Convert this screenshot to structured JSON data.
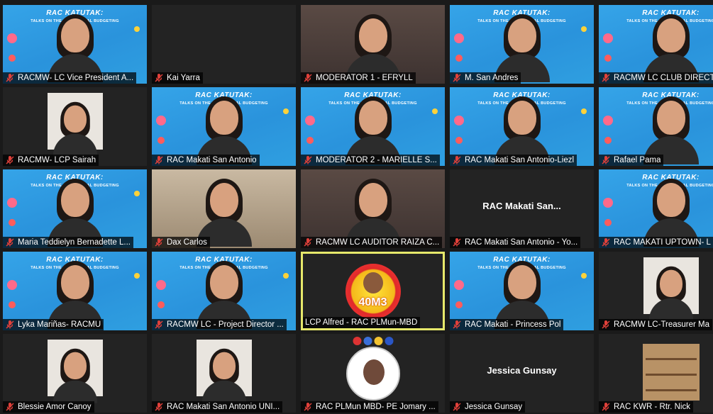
{
  "meeting": {
    "banner": {
      "title": "RAC KATUTAK:",
      "subtitle": "TALKS ON THE NEW NORMAL BUDGETING"
    },
    "participants": [
      {
        "name": "RACMW- LC Vice President A...",
        "muted": true,
        "view": "banner"
      },
      {
        "name": "Kai Yarra",
        "muted": true,
        "view": "plain"
      },
      {
        "name": "MODERATOR 1 - EFRYLL",
        "muted": true,
        "view": "room"
      },
      {
        "name": "M. San Andres",
        "muted": true,
        "view": "banner"
      },
      {
        "name": "RACMW LC CLUB DIRECTO",
        "muted": true,
        "view": "banner"
      },
      {
        "name": "RACMW- LCP Sairah",
        "muted": true,
        "view": "photo"
      },
      {
        "name": "RAC Makati San Antonio",
        "muted": true,
        "view": "banner"
      },
      {
        "name": "MODERATOR 2 - MARIELLE S...",
        "muted": true,
        "view": "banner"
      },
      {
        "name": "RAC Makati San Antonio-Liezl",
        "muted": true,
        "view": "banner"
      },
      {
        "name": "Rafael Pama",
        "muted": true,
        "view": "banner"
      },
      {
        "name": "Maria Teddielyn Bernadette L...",
        "muted": true,
        "view": "banner"
      },
      {
        "name": "Dax Carlos",
        "muted": true,
        "view": "room2"
      },
      {
        "name": "RACMW LC AUDITOR RAIZA C...",
        "muted": true,
        "view": "room"
      },
      {
        "name": "RAC Makati San Antonio - Yo...",
        "muted": true,
        "view": "name",
        "display": "RAC Makati San..."
      },
      {
        "name": "RAC MAKATI UPTOWN- L",
        "muted": true,
        "view": "banner"
      },
      {
        "name": "Lyka Mariñas- RACMU",
        "muted": true,
        "view": "photo-banner"
      },
      {
        "name": "RACMW LC - Project Director ...",
        "muted": true,
        "view": "banner"
      },
      {
        "name": "LCP Alfred - RAC PLMun-MBD",
        "muted": false,
        "view": "avatar",
        "avatar_text": "40M3",
        "active": true
      },
      {
        "name": "RAC Makati - Princess Pol",
        "muted": true,
        "view": "banner"
      },
      {
        "name": "RACMW LC-Treasurer Ma",
        "muted": true,
        "view": "photo"
      },
      {
        "name": "Blessie Amor Canoy",
        "muted": true,
        "view": "photo"
      },
      {
        "name": "RAC Makati San Antonio  UNI...",
        "muted": true,
        "view": "photo"
      },
      {
        "name": "RAC PLMun MBD- PE Jomary ...",
        "muted": true,
        "view": "logo"
      },
      {
        "name": "Jessica Gunsay",
        "muted": true,
        "view": "name",
        "display": "Jessica Gunsay"
      },
      {
        "name": "RAC KWR - Rtr. Nick",
        "muted": true,
        "view": "shelf"
      }
    ]
  },
  "colors": {
    "background": "#1a1a1a",
    "tile": "#232323",
    "active_speaker": "#e6e86b",
    "muted_icon": "#e0403a",
    "banner": "#35a4e8"
  }
}
